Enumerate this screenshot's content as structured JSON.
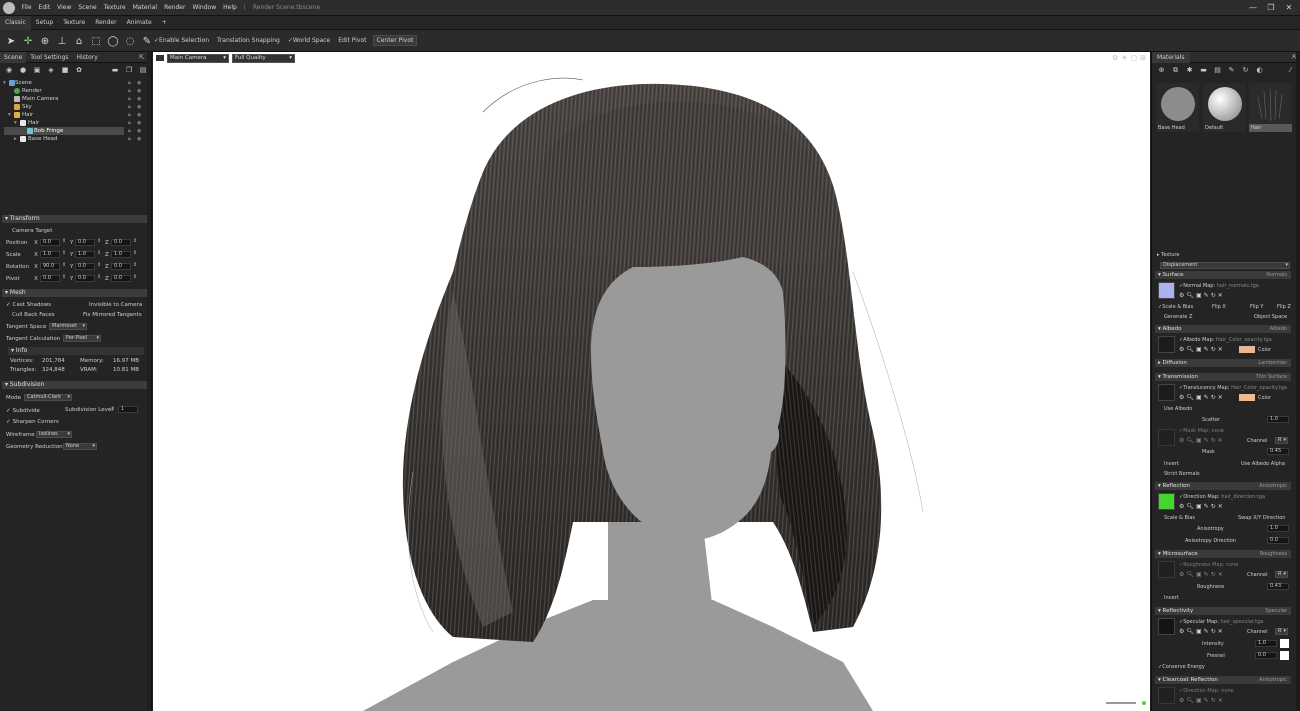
{
  "titlebar": {
    "menus": [
      "File",
      "Edit",
      "View",
      "Scene",
      "Texture",
      "Material",
      "Render",
      "Window",
      "Help"
    ],
    "document": "Render Scene.tbscene",
    "window_controls": {
      "minimize": "—",
      "maximize": "❐",
      "close": "✕"
    }
  },
  "workspace_tabs": [
    "Classic",
    "Setup",
    "Texture",
    "Render",
    "Animate",
    "+"
  ],
  "toolbar": {
    "tool_icons": [
      "select-arrow-icon",
      "transform-gizmo-icon",
      "rotate-gizmo-icon",
      "scale-gizmo-icon",
      "mesh-gizmo-icon",
      "rect-select-icon",
      "circle-select-icon",
      "lasso-select-icon",
      "paint-select-icon"
    ],
    "enable_selection": "✓Enable Selection",
    "translation_snapping": "Translation Snapping",
    "world_space": "✓World Space",
    "edit_pivot": "Edit Pivot",
    "center_pivot": "Center Pivot"
  },
  "left_panel": {
    "tabs": [
      "Scene",
      "Tool Settings",
      "History"
    ],
    "tree": [
      {
        "label": "Scene",
        "depth": 0,
        "icon": "scene-icon"
      },
      {
        "label": "Render",
        "depth": 1,
        "icon": "render-icon"
      },
      {
        "label": "Main Camera",
        "depth": 1,
        "icon": "camera-icon"
      },
      {
        "label": "Sky",
        "depth": 1,
        "icon": "sky-icon"
      },
      {
        "label": "Hair",
        "depth": 1,
        "icon": "folder-icon"
      },
      {
        "label": "Hair",
        "depth": 2,
        "icon": "mesh-icon"
      },
      {
        "label": "Bob Fringe",
        "depth": 3,
        "icon": "hair-icon",
        "selected": true
      },
      {
        "label": "Base Head",
        "depth": 2,
        "icon": "mesh-icon"
      }
    ],
    "transform": {
      "title": "Transform",
      "camera_target": "Camera Target",
      "rows": [
        {
          "label": "Position",
          "x": "0.0",
          "y": "0.0",
          "z": "0.0"
        },
        {
          "label": "Scale",
          "x": "1.0",
          "y": "1.0",
          "z": "1.0"
        },
        {
          "label": "Rotation",
          "x": "90.0",
          "y": "0.0",
          "z": "0.0"
        },
        {
          "label": "Pivot",
          "x": "0.0",
          "y": "0.0",
          "z": "0.0"
        }
      ]
    },
    "mesh": {
      "title": "Mesh",
      "cast_shadows": "Cast Shadows",
      "invisible_to_camera": "Invisible to Camera",
      "cull_back_faces": "Cull Back Faces",
      "fix_mirrored_tangents": "Fix Mirrored Tangents",
      "tangent_space_label": "Tangent Space",
      "tangent_space_value": "Marmoset",
      "tangent_calc_label": "Tangent Calculation",
      "tangent_calc_value": "Per-Pixel",
      "info_title": "Info",
      "vertices_label": "Vertices:",
      "vertices_value": "201,784",
      "memory_label": "Memory:",
      "memory_value": "16.97 MB",
      "triangles_label": "Triangles:",
      "triangles_value": "324,848",
      "vram_label": "VRAM:",
      "vram_value": "10.81 MB"
    },
    "subdivision": {
      "title": "Subdivision",
      "mode_label": "Mode",
      "mode_value": "Catmull-Clark",
      "subdivide": "Subdivide",
      "level_label": "Subdivision Level",
      "level_value": "1",
      "sharpen_corners": "Sharpen Corners",
      "wireframe_label": "Wireframe",
      "wireframe_value": "Isolines",
      "geo_reduction_label": "Geometry Reduction",
      "geo_reduction_value": "None"
    }
  },
  "viewport": {
    "camera": "Main Camera",
    "quality": "Full Quality"
  },
  "right_panel": {
    "tab": "Materials",
    "materials": [
      {
        "name": "Base Head",
        "swatch": "#8c8c8c"
      },
      {
        "name": "Default",
        "swatch": "#f2f2f2"
      },
      {
        "name": "Hair",
        "swatch": "#2b2b2b",
        "selected": true
      }
    ],
    "texture": "Texture",
    "displacement": "Displacement",
    "surface": {
      "title": "Surface",
      "mode": "Normals",
      "map": "Normal Map:",
      "file": "hair_normals.tga",
      "scale_bias": "✓Scale & Bias",
      "flip_x": "Flip X",
      "flip_y": "Flip Y",
      "flip_z": "Flip Z",
      "generate_z": "Generate Z",
      "object_space": "Object Space"
    },
    "albedo": {
      "title": "Albedo",
      "mode": "Albedo",
      "map": "Albedo Map:",
      "file": "Hair_Color_opacity.tga",
      "color": "Color",
      "swatch": "#e8b49a"
    },
    "diffusion": {
      "title": "Diffusion",
      "mode": "Lambertian"
    },
    "transmission": {
      "title": "Transmission",
      "mode": "Thin Surface",
      "map": "Translucency Map:",
      "file": "Hair_Color_opacity.tga",
      "color": "Color",
      "swatch": "#f0b88f",
      "use_albedo": "Use Albedo",
      "scatter_label": "Scatter",
      "scatter_value": "1.0",
      "mask_map": "Mask Map:",
      "mask_file": "none",
      "channel": "Channel",
      "channel_value": "R",
      "mask_label": "Mask",
      "mask_value": "0.45",
      "invert": "Invert",
      "use_albedo_alpha": "Use Albedo Alpha",
      "strict_normals": "Strict Normals"
    },
    "reflection": {
      "title": "Reflection",
      "mode": "Anisotropic",
      "map": "Direction Map:",
      "file": "hair_direction.tga",
      "scale_bias": "Scale & Bias",
      "swap": "Swap X/Y Direction",
      "anisotropy_label": "Anisotropy",
      "anisotropy_value": "1.0",
      "direction_label": "Anisotropy Direction",
      "direction_value": "0.0"
    },
    "microsurface": {
      "title": "Microsurface",
      "mode": "Roughness",
      "map": "Roughness Map:",
      "file": "none",
      "channel": "Channel",
      "channel_value": "R",
      "roughness_label": "Roughness",
      "roughness_value": "0.43",
      "invert": "Invert"
    },
    "reflectivity": {
      "title": "Reflectivity",
      "mode": "Specular",
      "map": "Specular Map:",
      "file": "hair_specular.tga",
      "channel": "Channel",
      "channel_value": "R",
      "intensity_label": "Intensity",
      "intensity_value": "1.0",
      "fresnel_label": "Fresnel",
      "fresnel_value": "0.0",
      "conserve": "Conserve Energy"
    },
    "clearcoat": {
      "title": "Clearcoat Reflection",
      "mode": "Anisotropic",
      "map": "Direction Map:",
      "file": "none"
    }
  }
}
